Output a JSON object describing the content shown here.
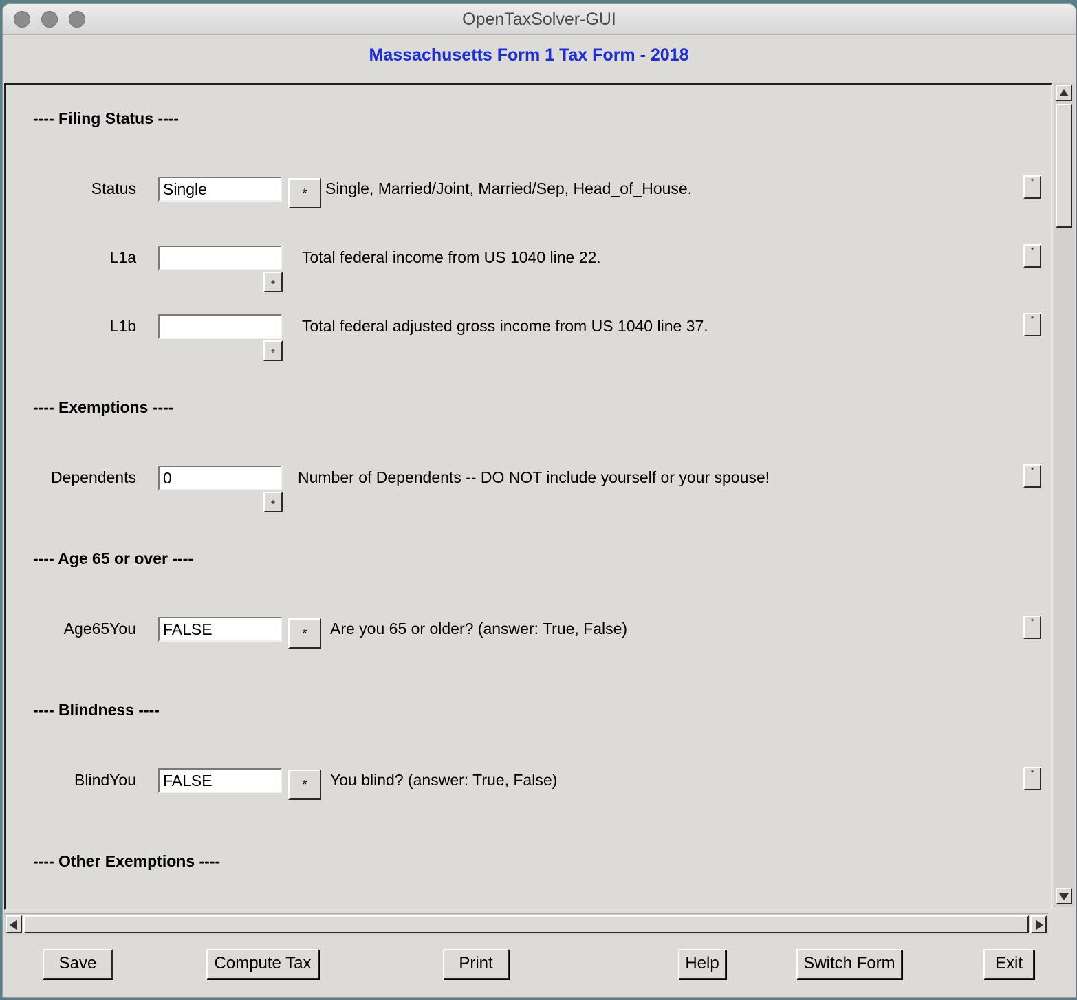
{
  "window": {
    "title": "OpenTaxSolver-GUI"
  },
  "form": {
    "title": "Massachusetts Form 1 Tax Form - 2018"
  },
  "sections": {
    "filing_status": "---- Filing Status ----",
    "exemptions": "---- Exemptions ----",
    "age65": "---- Age 65 or over ----",
    "blindness": "---- Blindness ----",
    "other_exemptions": "---- Other Exemptions ----"
  },
  "fields": {
    "status": {
      "label": "Status",
      "value": "Single",
      "button": "*",
      "description": "Single, Married/Joint, Married/Sep, Head_of_House."
    },
    "l1a": {
      "label": "L1a",
      "value": "",
      "button": "+",
      "description": "Total federal income from US 1040 line 22."
    },
    "l1b": {
      "label": "L1b",
      "value": "",
      "button": "+",
      "description": "Total federal adjusted gross income from US 1040 line 37."
    },
    "dependents": {
      "label": "Dependents",
      "value": "0",
      "button": "+",
      "description": "Number of Dependents -- DO NOT include yourself or your spouse!"
    },
    "age65you": {
      "label": "Age65You",
      "value": "FALSE",
      "button": "*",
      "description": "Are you 65 or older? (answer: True, False)"
    },
    "blindyou": {
      "label": "BlindYou",
      "value": "FALSE",
      "button": "*",
      "description": "You blind? (answer: True, False)"
    }
  },
  "side_button_label": "*",
  "buttons": {
    "save": "Save",
    "compute": "Compute Tax",
    "print": "Print",
    "help": "Help",
    "switch_form": "Switch Form",
    "exit": "Exit"
  }
}
